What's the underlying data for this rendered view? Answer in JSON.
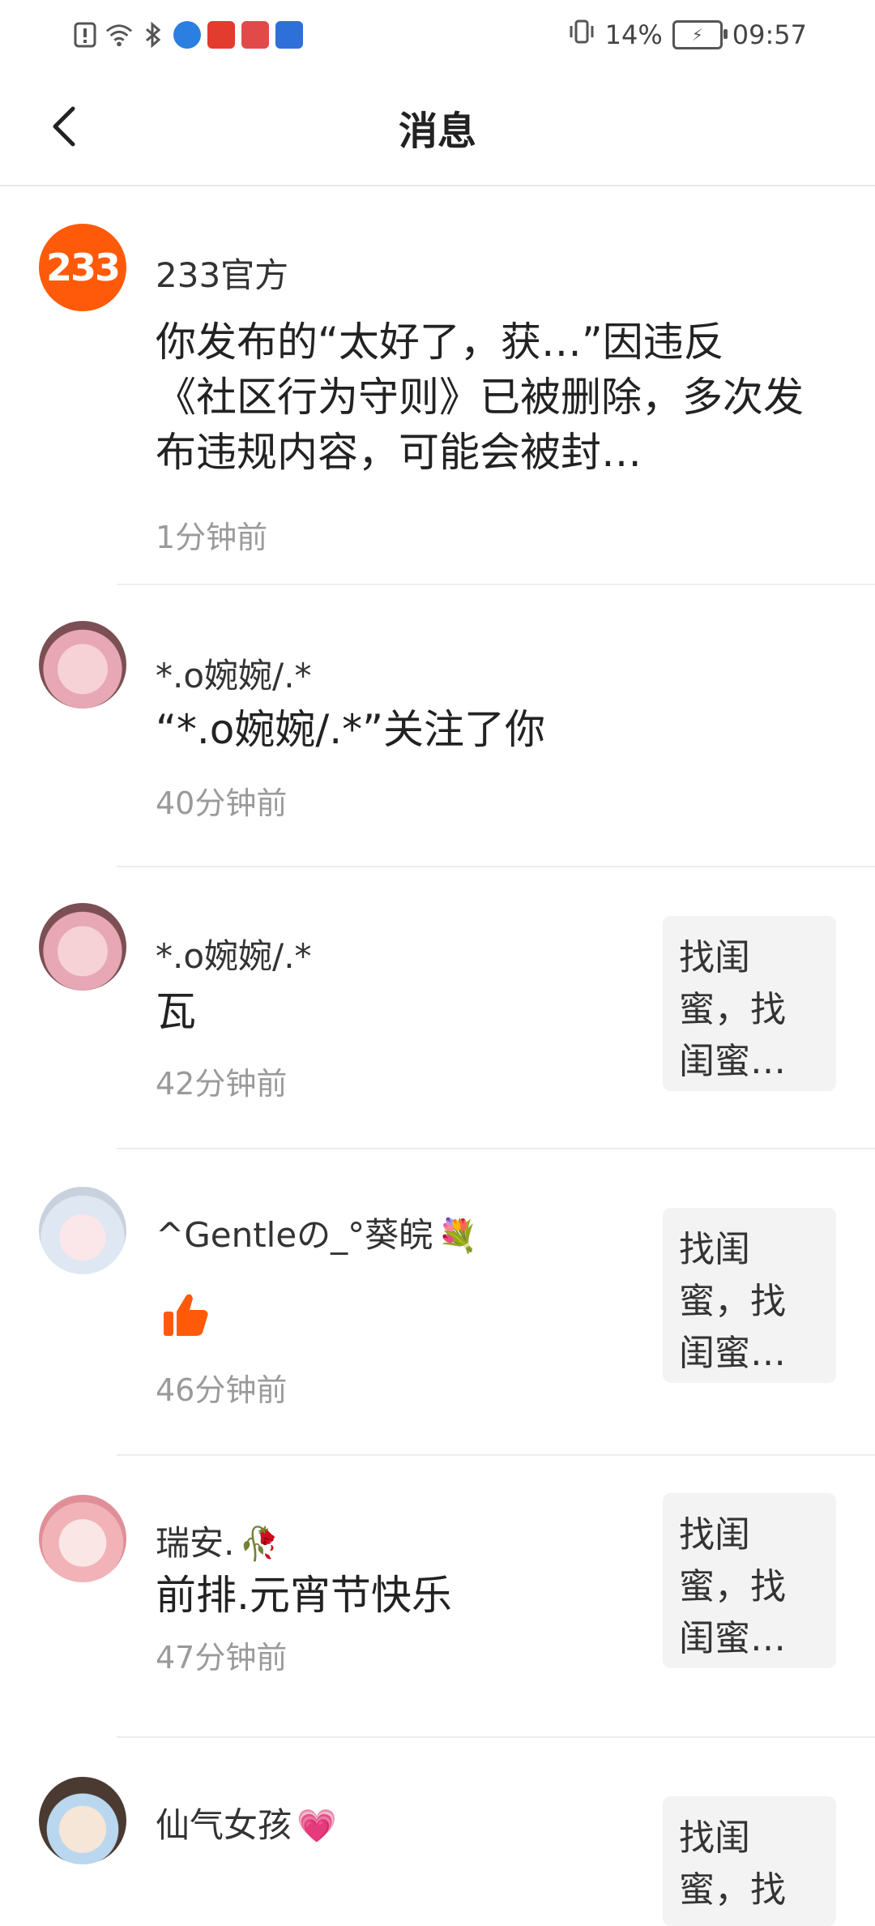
{
  "status_bar": {
    "battery": "14%",
    "time": "09:57",
    "left_icons": [
      "alert-icon",
      "wifi-icon",
      "bluetooth-icon",
      "browser-icon",
      "video-app-icon",
      "huawei-store-icon",
      "baidu-icon"
    ],
    "icon_colors": {
      "browser": "#2a7fe0",
      "video": "#e33b2e",
      "huawei": "#e24a4a",
      "baidu": "#2f6fd9"
    }
  },
  "header": {
    "title": "消息"
  },
  "messages": [
    {
      "name": "233官方",
      "text": "你发布的“太好了，获…”因违反《社区行为守则》已被删除，多次发布违规内容，可能会被封…",
      "time": "1分钟前",
      "avatar": "233-logo"
    },
    {
      "name": "*.o婉婉/.*",
      "text": "“*.o婉婉/.*”关注了你",
      "time": "40分钟前",
      "avatar": "pink-hair-girl"
    },
    {
      "name": "*.o婉婉/.*",
      "text": "瓦",
      "time": "42分钟前",
      "avatar": "pink-hair-girl",
      "preview": "找闺蜜，找闺蜜…"
    },
    {
      "name": "^Gentleの_°葵皖",
      "name_emoji": "💐",
      "text_icon": "thumbs-up-icon",
      "time": "46分钟前",
      "avatar": "white-hair-girl",
      "preview": "找闺蜜，找闺蜜…"
    },
    {
      "name": "瑞安.",
      "name_emoji": "🥀",
      "text": "前排.元宵节快乐",
      "time": "47分钟前",
      "avatar": "pink-girl",
      "preview": "找闺蜜，找闺蜜…"
    },
    {
      "name": "仙气女孩",
      "name_emoji": "💗",
      "avatar": "mask-boy",
      "preview": "找闺蜜，找"
    }
  ],
  "colors": {
    "accent": "#ff5a0a",
    "divider": "#eeeeee",
    "time_gray": "#9a9a9a"
  }
}
